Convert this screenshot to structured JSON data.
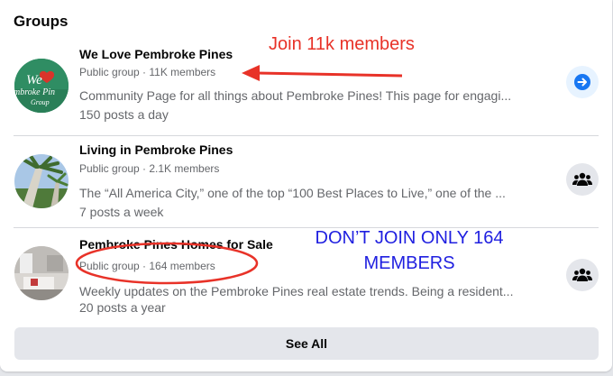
{
  "section": {
    "title": "Groups",
    "see_all_label": "See All"
  },
  "groups": [
    {
      "name": "We Love Pembroke Pines",
      "meta": "Public group · 11K members",
      "description": "Community Page for all things about Pembroke Pines! This page for engagi...",
      "activity": "150 posts a day",
      "avatar_text": "We",
      "avatar_subtext": "mbroke Pin",
      "avatar_subtext2": "Group",
      "action_icon": "arrow-right-icon"
    },
    {
      "name": "Living in Pembroke Pines",
      "meta": "Public group · 2.1K members",
      "description": "The “All America City,” one of the top “100 Best Places to Live,” one of the ...",
      "activity": "7 posts a week",
      "action_icon": "group-join-icon"
    },
    {
      "name": "Pembroke Pines Homes for Sale",
      "meta": "Public group · 164 members",
      "description": "Weekly updates on the Pembroke Pines real estate trends. Being a resident...",
      "activity": "20 posts a year",
      "action_icon": "group-join-icon"
    }
  ],
  "annotations": {
    "red_note": "Join 11k members",
    "blue_note_line1": "DON’T JOIN ONLY 164",
    "blue_note_line2": "MEMBERS"
  },
  "colors": {
    "annotation_red": "#e83228",
    "annotation_blue": "#1f1fe0",
    "link_blue": "#1877f2",
    "secondary_text": "#65676b"
  }
}
